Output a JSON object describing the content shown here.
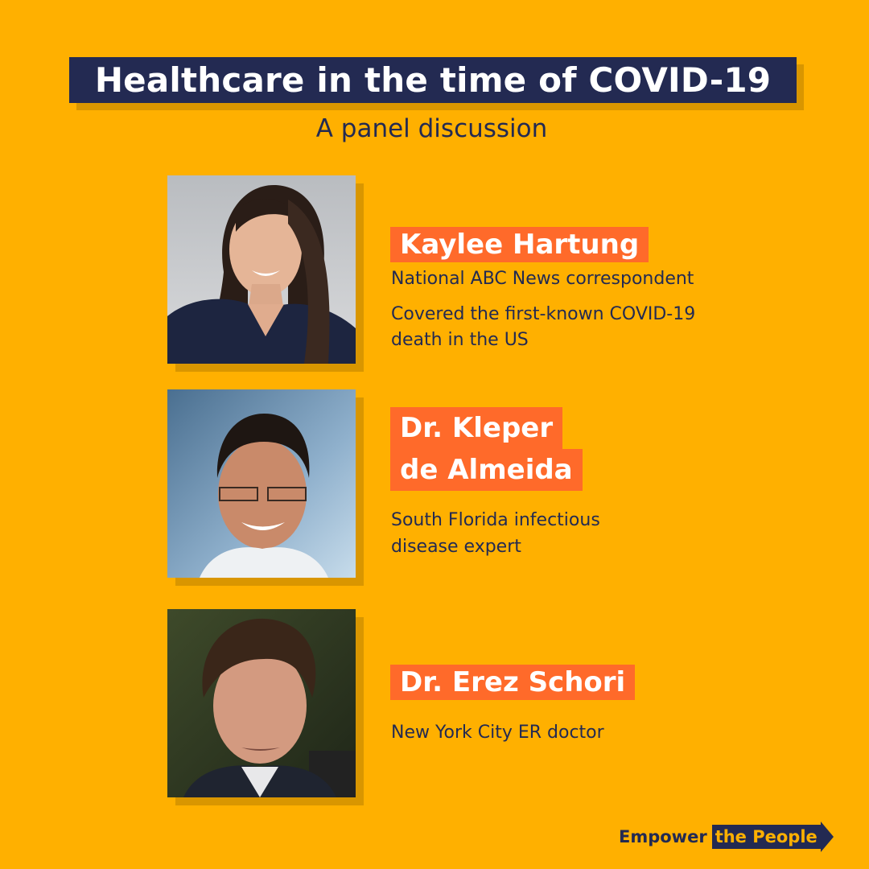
{
  "header": {
    "title": "Healthcare in the time of COVID-19",
    "subtitle": "A panel discussion"
  },
  "panelists": [
    {
      "name": "Kaylee Hartung",
      "desc": [
        "National ABC News correspondent",
        "Covered the first-known COVID-19",
        "death in the US"
      ]
    },
    {
      "name_lines": [
        "Dr. Kleper",
        "de Almeida"
      ],
      "desc": [
        "South Florida infectious",
        "disease expert"
      ]
    },
    {
      "name": "Dr. Erez Schori",
      "desc": [
        "New York City ER doctor"
      ]
    }
  ],
  "logo": {
    "part1": "Empower",
    "part2": "the People"
  },
  "colors": {
    "background": "#FFB000",
    "navy": "#232A52",
    "accent": "#FF6A2A"
  }
}
